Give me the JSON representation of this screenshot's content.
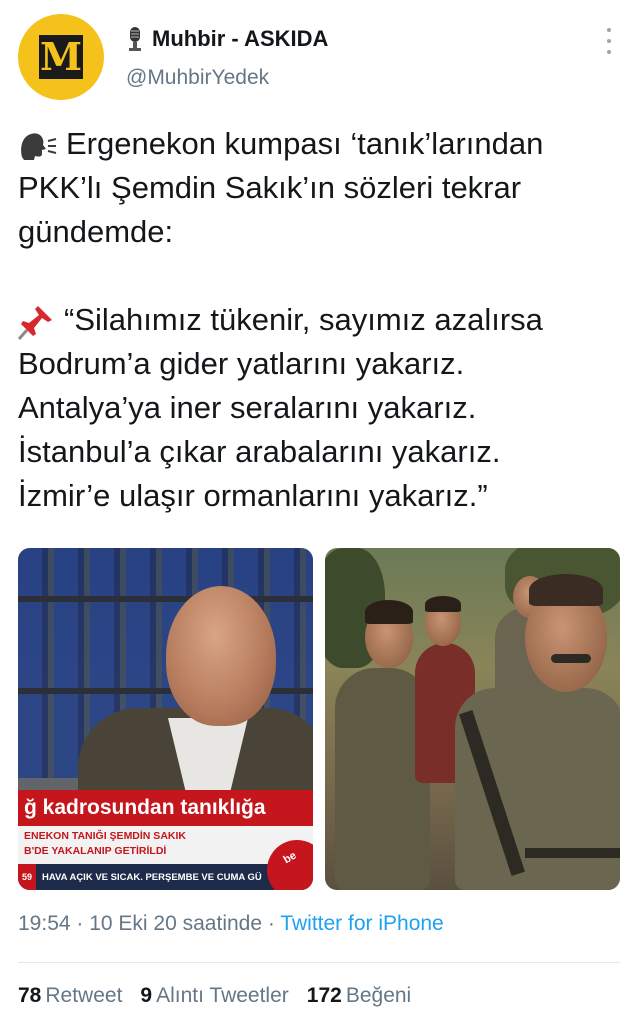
{
  "author": {
    "display_name": "Muhbir - ASKIDA",
    "handle": "@MuhbirYedek",
    "avatar_letter": "M"
  },
  "tweet": {
    "lines_intro": [
      "Ergenekon kumpası ‘tanık’larından",
      "PKK’lı Şemdin Sakık’ın sözleri tekrar",
      "gündemde:"
    ],
    "lines_quote": [
      "“Silahımız tükenir, sayımız azalırsa",
      "Bodrum’a gider yatlarını yakarız.",
      "Antalya’ya iner seralarını yakarız.",
      "İstanbul’a çıkar arabalarını yakarız.",
      "İzmir’e ulaşır ormanlarını yakarız.”"
    ],
    "intro_icon": "speaking-head-icon",
    "quote_icon": "pushpin-icon"
  },
  "media": {
    "left_photo": {
      "banner_red": "ğ kadrosundan tanıklığa",
      "banner_line1": "ENEKON TANIĞI ŞEMDİN SAKIK",
      "banner_line2": "B'DE YAKALANIP GETİRİLDİ",
      "ticker_num": "59",
      "ticker_text": "HAVA AÇIK VE SICAK. PERŞEMBE VE CUMA GÜ",
      "corner_logo": "be"
    }
  },
  "meta": {
    "time": "19:54",
    "separator": " · ",
    "date": "10 Eki 20 saatinde",
    "source": "Twitter for iPhone"
  },
  "stats": {
    "retweets_count": "78",
    "retweets_label": "Retweet",
    "quotes_count": "9",
    "quotes_label": "Alıntı Tweetler",
    "likes_count": "172",
    "likes_label": "Beğeni"
  },
  "colors": {
    "link": "#1da1f2",
    "secondary_text": "#657786",
    "avatar_bg": "#f4c21b",
    "news_red": "#c4161c"
  }
}
